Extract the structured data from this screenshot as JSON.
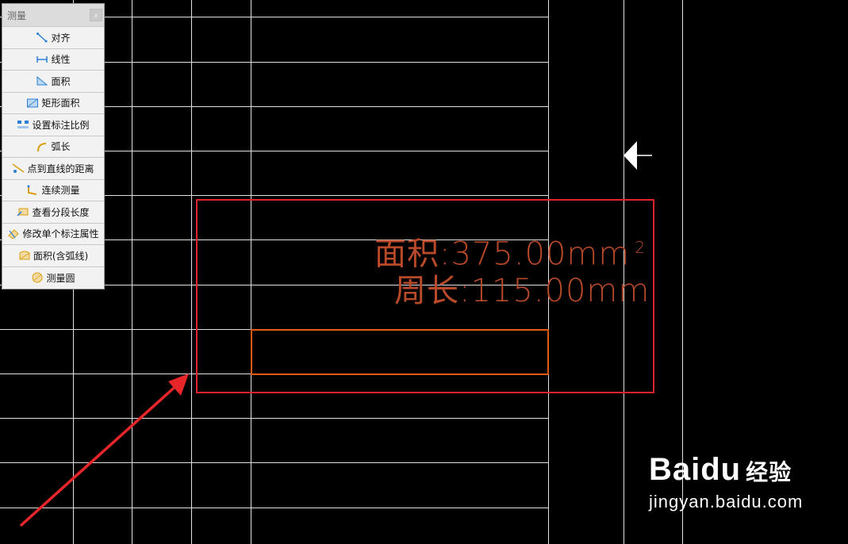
{
  "panel": {
    "title": "测量",
    "close": "x",
    "items": [
      {
        "label": "对齐",
        "icon": "align-icon"
      },
      {
        "label": "线性",
        "icon": "linear-icon"
      },
      {
        "label": "面积",
        "icon": "area-icon"
      },
      {
        "label": "矩形面积",
        "icon": "rect-area-icon"
      },
      {
        "label": "设置标注比例",
        "icon": "scale-icon"
      },
      {
        "label": "弧长",
        "icon": "arc-length-icon"
      },
      {
        "label": "点到直线的距离",
        "icon": "point-line-distance-icon"
      },
      {
        "label": "连续测量",
        "icon": "continuous-measure-icon"
      },
      {
        "label": "查看分段长度",
        "icon": "segment-length-icon"
      },
      {
        "label": "修改单个标注属性",
        "icon": "edit-annotation-icon"
      },
      {
        "label": "面积(含弧线)",
        "icon": "area-arc-icon"
      },
      {
        "label": "测量圆",
        "icon": "measure-circle-icon"
      }
    ]
  },
  "drawing": {
    "area_text": "面积:375.00mm",
    "area_sup": "2",
    "perimeter_text": "周长:115.00mm",
    "colors": {
      "background": "#000000",
      "grid": "#e0e0e0",
      "measure_rect": "#e0242a",
      "shape_rect": "#e05a12",
      "text": "#b84a2a",
      "annotation_arrow": "#e8262a"
    }
  },
  "watermark": {
    "logo_text": "Baidu",
    "logo_cn": "经验",
    "url": "jingyan.baidu.com"
  }
}
